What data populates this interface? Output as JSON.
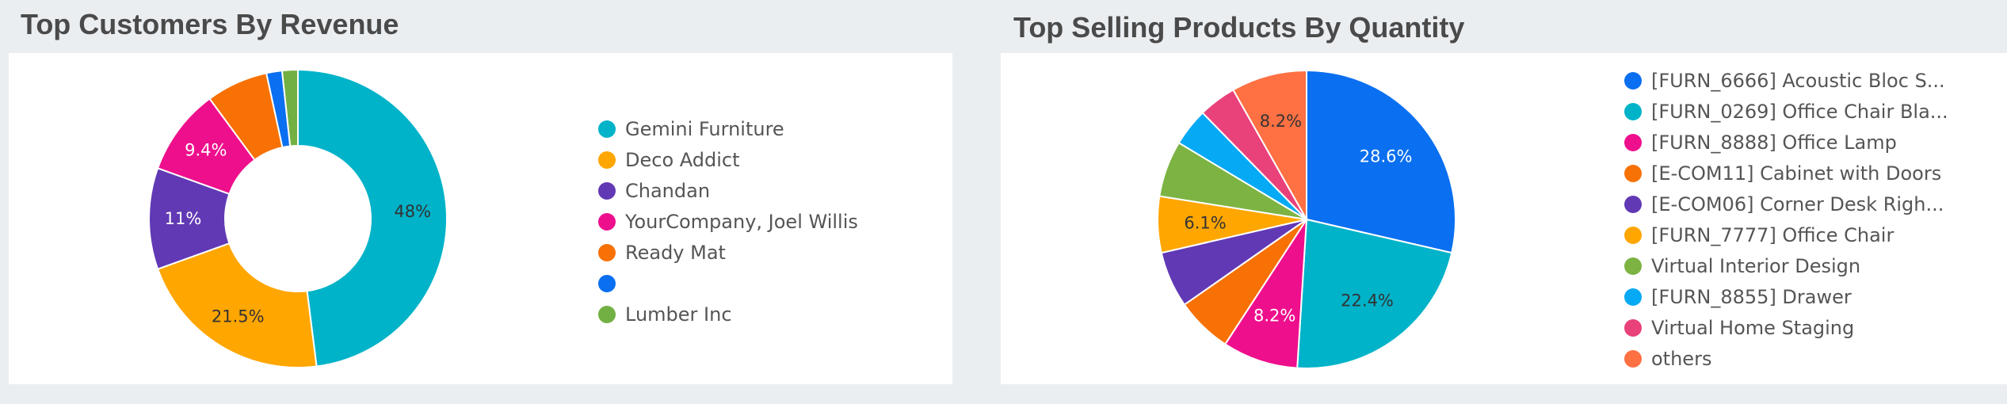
{
  "page": {
    "left_title": "Top Customers By Revenue",
    "right_title": "Top Selling Products By Quantity"
  },
  "chart_data": [
    {
      "type": "pie",
      "variant": "donut",
      "title": "Top Customers By Revenue",
      "legend_position": "right",
      "series": [
        {
          "name": "Gemini Furniture",
          "value": 48.0,
          "label": "48%",
          "color": "#00b3c9",
          "label_color": "#333333"
        },
        {
          "name": "Deco Addict",
          "value": 21.5,
          "label": "21.5%",
          "color": "#ffa600",
          "label_color": "#333333"
        },
        {
          "name": "Chandan",
          "value": 11.0,
          "label": "11%",
          "color": "#6139b4",
          "label_color": "#ffffff"
        },
        {
          "name": "YourCompany, Joel Willis",
          "value": 9.4,
          "label": "9.4%",
          "color": "#ee0f8c",
          "label_color": "#ffffff"
        },
        {
          "name": "Ready Mat",
          "value": 6.7,
          "label": "",
          "color": "#f77105",
          "label_color": "#ffffff"
        },
        {
          "name": "",
          "value": 1.7,
          "label": "",
          "color": "#0a6ff0",
          "label_color": "#ffffff"
        },
        {
          "name": "Lumber Inc",
          "value": 1.7,
          "label": "",
          "color": "#72b043",
          "label_color": "#ffffff"
        }
      ]
    },
    {
      "type": "pie",
      "title": "Top Selling Products By Quantity",
      "legend_position": "right",
      "series": [
        {
          "name": "[FURN_6666] Acoustic Bloc S...",
          "value": 28.6,
          "label": "28.6%",
          "color": "#0a6ff0",
          "label_color": "#ffffff"
        },
        {
          "name": "[FURN_0269] Office Chair Bla...",
          "value": 22.4,
          "label": "22.4%",
          "color": "#00b3c9",
          "label_color": "#333333"
        },
        {
          "name": "[FURN_8888] Office Lamp",
          "value": 8.2,
          "label": "8.2%",
          "color": "#ee0f8c",
          "label_color": "#ffffff"
        },
        {
          "name": "[E-COM11] Cabinet with Doors",
          "value": 6.1,
          "label": "",
          "color": "#f77105",
          "label_color": "#ffffff"
        },
        {
          "name": "[E-COM06] Corner Desk Righ...",
          "value": 6.1,
          "label": "",
          "color": "#6139b4",
          "label_color": "#ffffff"
        },
        {
          "name": "[FURN_7777] Office Chair",
          "value": 6.1,
          "label": "6.1%",
          "color": "#ffa600",
          "label_color": "#333333"
        },
        {
          "name": "Virtual Interior Design",
          "value": 6.1,
          "label": "",
          "color": "#7cb342",
          "label_color": "#ffffff"
        },
        {
          "name": "[FURN_8855] Drawer",
          "value": 4.1,
          "label": "",
          "color": "#05a9f4",
          "label_color": "#ffffff"
        },
        {
          "name": "Virtual Home Staging",
          "value": 4.1,
          "label": "",
          "color": "#e9417a",
          "label_color": "#ffffff"
        },
        {
          "name": "others",
          "value": 8.2,
          "label": "8.2%",
          "color": "#ff7043",
          "label_color": "#333333"
        }
      ]
    }
  ]
}
